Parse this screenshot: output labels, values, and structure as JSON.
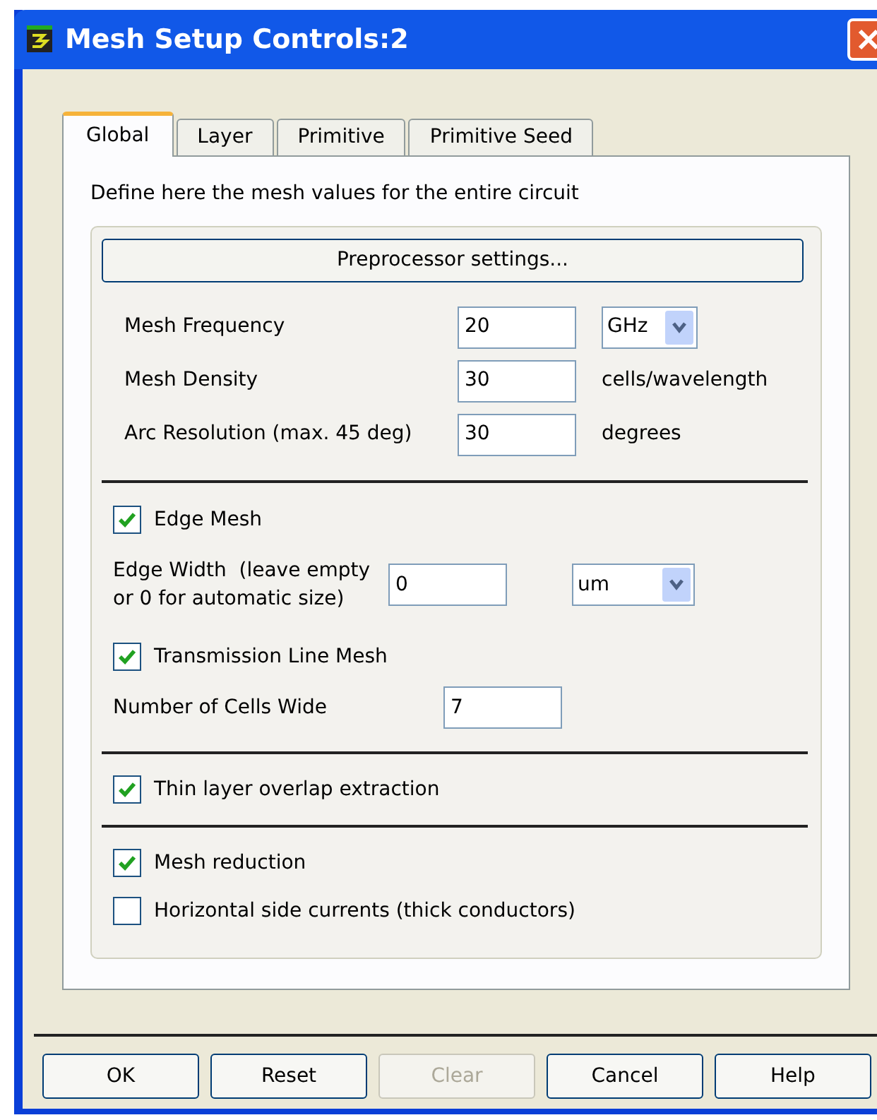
{
  "window": {
    "title": "Mesh Setup Controls:2"
  },
  "tabs": [
    {
      "label": "Global",
      "selected": true
    },
    {
      "label": "Layer",
      "selected": false
    },
    {
      "label": "Primitive",
      "selected": false
    },
    {
      "label": "Primitive Seed",
      "selected": false
    }
  ],
  "description": "Define here the mesh values for the entire circuit",
  "preprocessor_button": "Preprocessor settings...",
  "fields": [
    {
      "label": "Mesh Frequency",
      "value": "20",
      "kind": "dropdown",
      "unit": "GHz"
    },
    {
      "label": "Mesh Density",
      "value": "30",
      "kind": "text",
      "unit": "cells/wavelength"
    },
    {
      "label": "Arc Resolution (max. 45 deg)",
      "value": "30",
      "kind": "text",
      "unit": "degrees"
    }
  ],
  "edge_mesh": {
    "label": "Edge Mesh",
    "checked": true
  },
  "edge_width": {
    "label_lines": [
      "Edge Width  (leave empty",
      "or 0 for automatic size)"
    ],
    "value": "0",
    "unit": "um"
  },
  "transmission_line_mesh": {
    "label": "Transmission Line Mesh",
    "checked": true
  },
  "cells_wide": {
    "label": "Number of Cells Wide",
    "value": "7"
  },
  "thin_layer": {
    "label": "Thin layer overlap extraction",
    "checked": true
  },
  "mesh_reduction": {
    "label": "Mesh reduction",
    "checked": true
  },
  "horizontal_side_currents": {
    "label": "Horizontal side currents (thick conductors)",
    "checked": false
  },
  "buttons": [
    {
      "label": "OK",
      "disabled": false
    },
    {
      "label": "Reset",
      "disabled": false
    },
    {
      "label": "Clear",
      "disabled": true
    },
    {
      "label": "Cancel",
      "disabled": false
    },
    {
      "label": "Help",
      "disabled": false
    }
  ]
}
